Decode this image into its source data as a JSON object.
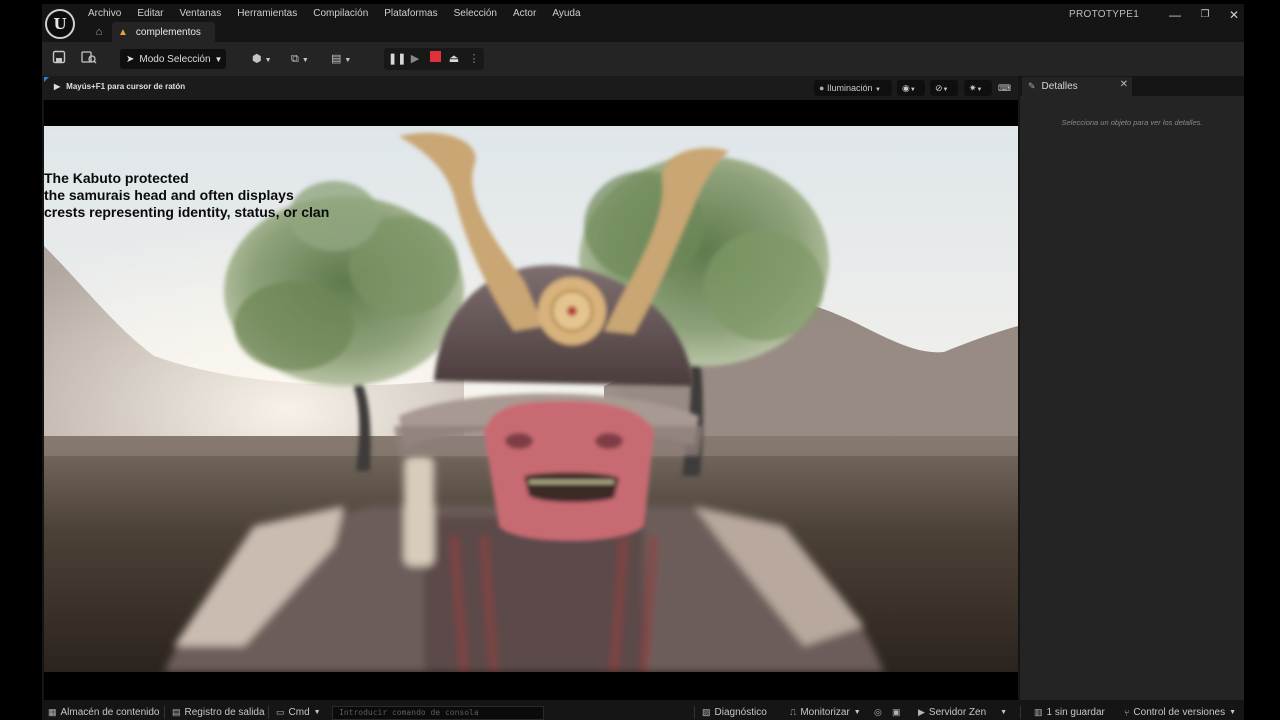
{
  "titlebar": {
    "logo_text": "U",
    "menu": [
      "Archivo",
      "Editar",
      "Ventanas",
      "Herramientas",
      "Compilación",
      "Plataformas",
      "Selección",
      "Actor",
      "Ayuda"
    ],
    "project_tab": "complementos",
    "project_name": "PROTOTYPE1",
    "window_buttons": {
      "minimize": "—",
      "restore": "❐",
      "close": "✕"
    }
  },
  "toolbar": {
    "mode_label": "Modo Selección"
  },
  "viewport": {
    "hint": "Mayús+F1 para cursor de ratón",
    "lighting_label": "Iluminación",
    "caption_lines": [
      "The Kabuto protected",
      "the samurais head and often displays",
      "crests representing identity, status, or clan"
    ]
  },
  "details": {
    "tab_label": "Detalles",
    "empty_text": "Selecciona un objeto para ver los detalles."
  },
  "statusbar": {
    "content_drawer": "Almacén de contenido",
    "output_log": "Registro de salida",
    "cmd": "Cmd",
    "console_placeholder": "Introducir comando de consola",
    "diagnostics": "Diagnóstico",
    "monitor": "Monitorizar",
    "zen_server": "Servidor Zen",
    "unsaved": "1 sin guardar",
    "source_control": "Control de versiones"
  }
}
